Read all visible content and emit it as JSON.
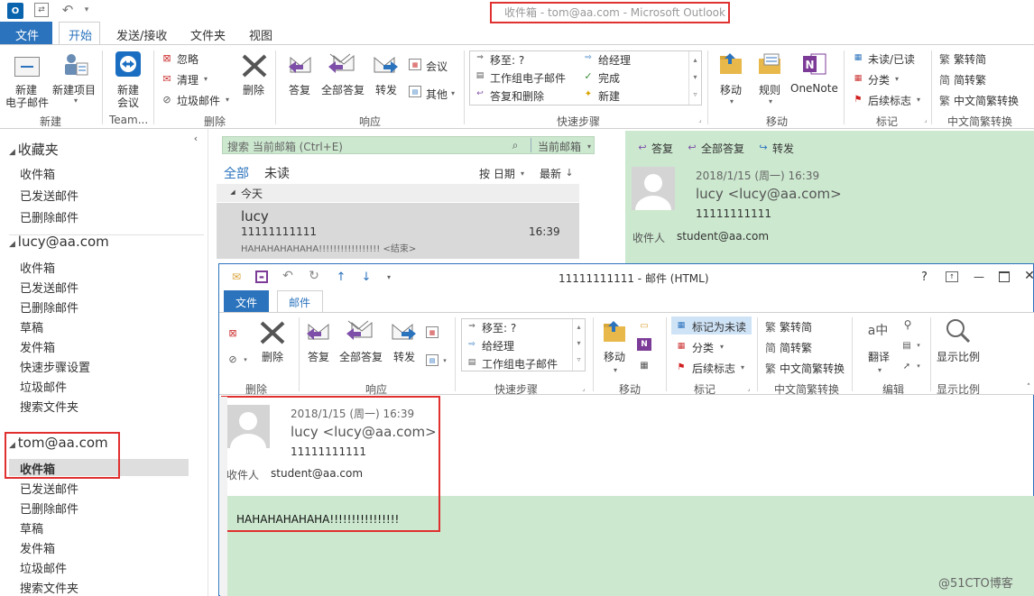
{
  "main": {
    "title": "收件箱 - tom@aa.com - Microsoft Outlook",
    "tabs": [
      "文件",
      "开始",
      "发送/接收",
      "文件夹",
      "视图"
    ],
    "ribbon": {
      "new_email": "新建\n电子邮件",
      "new_email_l1": "新建",
      "new_email_l2": "电子邮件",
      "new_item": "新建项目",
      "new_meeting_l1": "新建",
      "new_meeting_l2": "会议",
      "ignore": "忽略",
      "cleanup": "清理",
      "junk": "垃圾邮件",
      "delete": "删除",
      "reply": "答复",
      "reply_all": "全部答复",
      "forward": "转发",
      "meeting": "会议",
      "more": "其他",
      "qs_items": [
        "移至: ?",
        "工作组电子邮件",
        "答复和删除",
        "给经理",
        "完成",
        "新建"
      ],
      "move": "移动",
      "rules": "规则",
      "onenote": "OneNote",
      "unread_read": "未读/已读",
      "categorize": "分类",
      "followup": "后续标志",
      "trad_to_simp_a": "繁转简",
      "simp_to_trad": "简转繁",
      "chinese_conv": "中文简繁转换",
      "groups": [
        "新建",
        "Team...",
        "删除",
        "响应",
        "快速步骤",
        "移动",
        "标记",
        "中文简繁转换"
      ]
    }
  },
  "nav": {
    "favorites_title": "收藏夹",
    "favorites": [
      "收件箱",
      "已发送邮件",
      "已删除邮件"
    ],
    "lucy_account": "lucy@aa.com",
    "lucy_folders": [
      "收件箱",
      "已发送邮件",
      "已删除邮件",
      "草稿",
      "发件箱",
      "快速步骤设置",
      "垃圾邮件",
      "搜索文件夹"
    ],
    "tom_account": "tom@aa.com",
    "tom_folders": [
      "收件箱",
      "已发送邮件",
      "已删除邮件",
      "草稿",
      "发件箱",
      "垃圾邮件",
      "搜索文件夹"
    ]
  },
  "list": {
    "search_placeholder": "搜索 当前邮箱 (Ctrl+E)",
    "scope": "当前邮箱",
    "filter_all": "全部",
    "filter_unread": "未读",
    "sort_by": "按 日期",
    "sort_order": "最新",
    "group_today": "今天",
    "item": {
      "sender": "lucy",
      "subject": "11111111111",
      "time": "16:39",
      "preview": "HAHAHAHAHAHA!!!!!!!!!!!!!!!!! <结束>"
    }
  },
  "reading": {
    "reply": "答复",
    "reply_all": "全部答复",
    "forward": "转发",
    "date": "2018/1/15 (周一) 16:39",
    "from": "lucy <lucy@aa.com>",
    "subject": "11111111111",
    "to_label": "收件人",
    "to": "student@aa.com"
  },
  "popup": {
    "title": "11111111111 - 邮件 (HTML)",
    "help": "?",
    "tabs": [
      "文件",
      "邮件"
    ],
    "ribbon": {
      "delete": "删除",
      "reply": "答复",
      "reply_all": "全部答复",
      "forward": "转发",
      "qs_items": [
        "移至: ?",
        "给经理",
        "工作组电子邮件"
      ],
      "move": "移动",
      "mark_unread": "标记为未读",
      "categorize": "分类",
      "followup": "后续标志",
      "trad_to_simp": "繁转简",
      "simp_to_trad": "简转繁",
      "chinese_conv": "中文简繁转换",
      "translate": "翻译",
      "zoom": "显示比例",
      "groups": [
        "删除",
        "响应",
        "快速步骤",
        "移动",
        "标记",
        "中文简繁转换",
        "编辑",
        "显示比例"
      ]
    },
    "date": "2018/1/15 (周一) 16:39",
    "from": "lucy <lucy@aa.com>",
    "subject": "11111111111",
    "to_label": "收件人",
    "to": "student@aa.com",
    "body": "HAHAHAHAHAHA!!!!!!!!!!!!!!!!"
  },
  "watermark": "@51CTO博客",
  "colors": {
    "accent": "#2b73bd",
    "highlight_green": "#cce8cf",
    "red_box": "#e03030"
  }
}
